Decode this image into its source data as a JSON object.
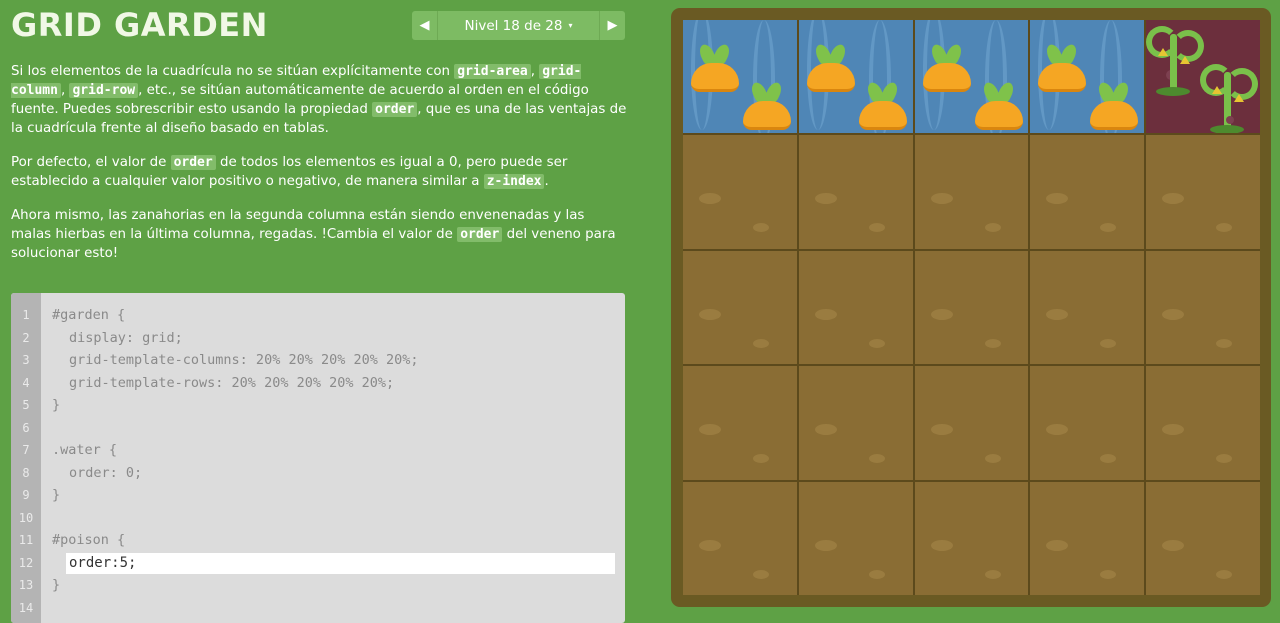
{
  "header": {
    "title": "GRID GARDEN",
    "level_label": "Nivel 18 de 28",
    "prev_symbol": "◀",
    "next_symbol": "▶",
    "dropdown_symbol": "▾"
  },
  "instructions": {
    "p1": {
      "t1": "Si los elementos de la cuadrícula no se sitúan explícitamente con ",
      "c1": "grid-area",
      "t2": ", ",
      "c2": "grid-column",
      "t3": ", ",
      "c3": "grid-row",
      "t4": ", etc., se sitúan automáticamente de acuerdo al orden en el código fuente. Puedes sobrescribir esto usando la propiedad ",
      "c4": "order",
      "t5": ", que es una de las ventajas de la cuadrícula frente al diseño basado en tablas."
    },
    "p2": {
      "t1": "Por defecto, el valor de ",
      "c1": "order",
      "t2": " de todos los elementos es igual a 0, pero puede ser establecido a cualquier valor positivo o negativo, de manera similar a ",
      "c2": "z-index",
      "t3": "."
    },
    "p3": {
      "t1": "Ahora mismo, las zanahorias en la segunda columna están siendo envenenadas y las malas hierbas en la última columna, regadas. !Cambia el valor de ",
      "c1": "order",
      "t2": " del veneno para solucionar esto!"
    }
  },
  "editor": {
    "line_numbers": [
      "1",
      "2",
      "3",
      "4",
      "5",
      "6",
      "7",
      "8",
      "9",
      "10",
      "11",
      "12",
      "13",
      "14"
    ],
    "lines": [
      "#garden {",
      "display: grid;",
      "grid-template-columns: 20% 20% 20% 20% 20%;",
      "grid-template-rows: 20% 20% 20% 20% 20%;",
      "}",
      "",
      ".water {",
      "order: 0;",
      "}",
      "",
      "#poison {",
      "",
      "}",
      ""
    ],
    "input_value": "order:5;"
  },
  "board": {
    "colors": {
      "water": "#4f86b6",
      "poison": "#6c2f3d",
      "dirt": "#8a6d34",
      "frame": "#6a5a23",
      "carrot": "#f5a623",
      "leaf": "#7fc24a"
    },
    "row1": [
      "water",
      "water",
      "water",
      "water",
      "poison"
    ]
  }
}
